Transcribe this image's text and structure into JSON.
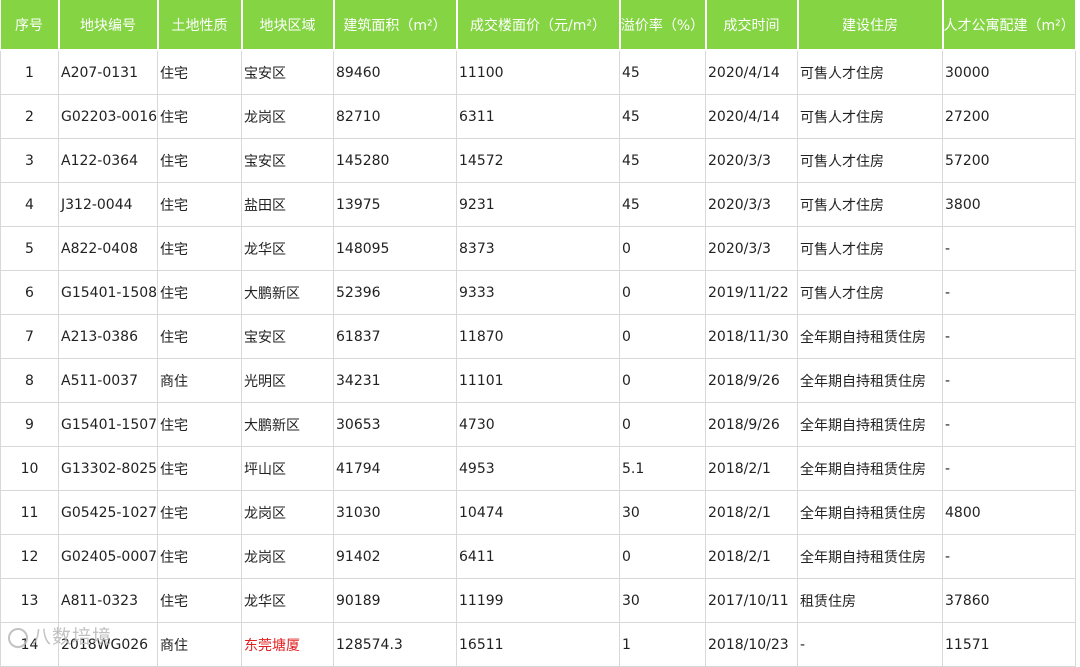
{
  "headers": [
    "序号",
    "地块编号",
    "土地性质",
    "地块区域",
    "建筑面积（m²）",
    "成交楼面价（元/m²）",
    "溢价率（%）",
    "成交时间",
    "建设住房",
    "人才公寓配建（m²）"
  ],
  "rows": [
    [
      "1",
      "A207-0131",
      "住宅",
      "宝安区",
      "89460",
      "11100",
      "45",
      "2020/4/14",
      "可售人才住房",
      "30000"
    ],
    [
      "2",
      "G02203-0016",
      "住宅",
      "龙岗区",
      "82710",
      "6311",
      "45",
      "2020/4/14",
      "可售人才住房",
      "27200"
    ],
    [
      "3",
      "A122-0364",
      "住宅",
      "宝安区",
      "145280",
      "14572",
      "45",
      "2020/3/3",
      "可售人才住房",
      "57200"
    ],
    [
      "4",
      "J312-0044",
      "住宅",
      "盐田区",
      "13975",
      "9231",
      "45",
      "2020/3/3",
      "可售人才住房",
      "3800"
    ],
    [
      "5",
      "A822-0408",
      "住宅",
      "龙华区",
      "148095",
      "8373",
      "0",
      "2020/3/3",
      "可售人才住房",
      "-"
    ],
    [
      "6",
      "G15401-1508",
      "住宅",
      "大鹏新区",
      "52396",
      "9333",
      "0",
      "2019/11/22",
      "可售人才住房",
      "-"
    ],
    [
      "7",
      "A213-0386",
      "住宅",
      "宝安区",
      "61837",
      "11870",
      "0",
      "2018/11/30",
      "全年期自持租赁住房",
      "-"
    ],
    [
      "8",
      "A511-0037",
      "商住",
      "光明区",
      "34231",
      "11101",
      "0",
      "2018/9/26",
      "全年期自持租赁住房",
      "-"
    ],
    [
      "9",
      "G15401-1507",
      "住宅",
      "大鹏新区",
      "30653",
      "4730",
      "0",
      "2018/9/26",
      "全年期自持租赁住房",
      "-"
    ],
    [
      "10",
      "G13302-8025",
      "住宅",
      "坪山区",
      "41794",
      "4953",
      "5.1",
      "2018/2/1",
      "全年期自持租赁住房",
      "-"
    ],
    [
      "11",
      "G05425-1027",
      "住宅",
      "龙岗区",
      "31030",
      "10474",
      "30",
      "2018/2/1",
      "全年期自持租赁住房",
      "4800"
    ],
    [
      "12",
      "G02405-0007",
      "住宅",
      "龙岗区",
      "91402",
      "6411",
      "0",
      "2018/2/1",
      "全年期自持租赁住房",
      "-"
    ],
    [
      "13",
      "A811-0323",
      "住宅",
      "龙华区",
      "90189",
      "11199",
      "30",
      "2017/10/11",
      "租赁住房",
      "37860"
    ],
    [
      "14",
      "2018WG026",
      "商住",
      "东莞塘厦",
      "128574.3",
      "16511",
      "1",
      "2018/10/23",
      "-",
      "11571"
    ]
  ],
  "highlight": {
    "row": 13,
    "col": 3,
    "color": "#e02020"
  },
  "watermark": "八数培境",
  "colors": {
    "header_bg": "#84d443",
    "border": "#d8d8d8",
    "highlight": "#e02020"
  }
}
